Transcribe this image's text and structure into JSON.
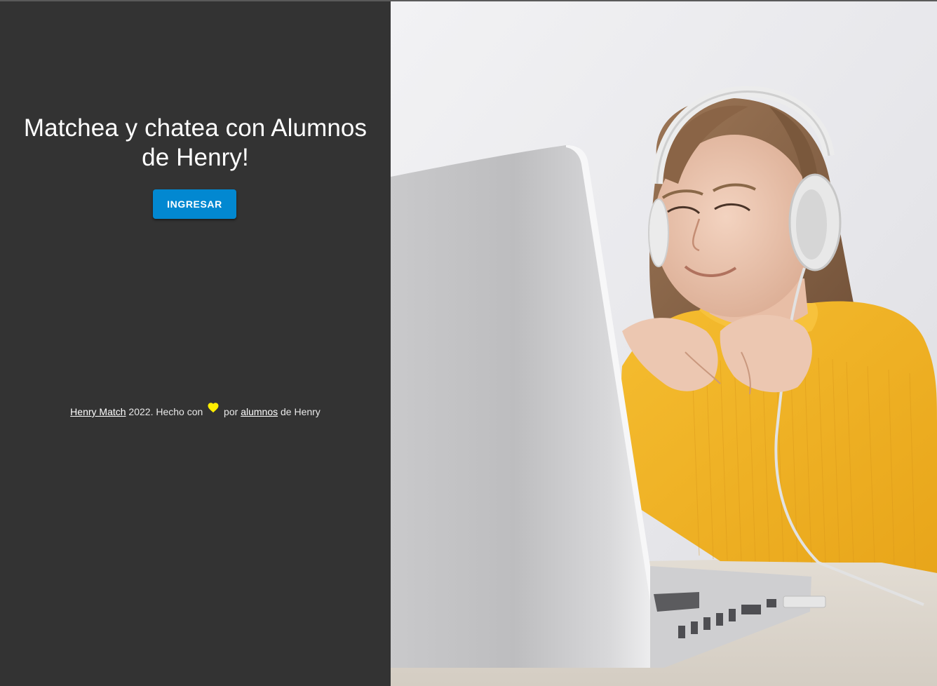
{
  "hero": {
    "title": "Matchea y chatea con Alumnos de Henry!",
    "login_button_label": "INGRESAR"
  },
  "footer": {
    "brand_link": "Henry Match",
    "text_after_brand": " 2022. Hecho con ",
    "heart_icon": "heart-icon",
    "text_por": " por ",
    "students_link": "alumnos",
    "text_end": " de Henry"
  },
  "colors": {
    "left_panel_bg": "#333333",
    "button_bg": "#0288d1",
    "heart": "#ffee00",
    "sweater": "#f0b323"
  },
  "photo": {
    "subject": "woman-with-headphones-using-laptop"
  }
}
